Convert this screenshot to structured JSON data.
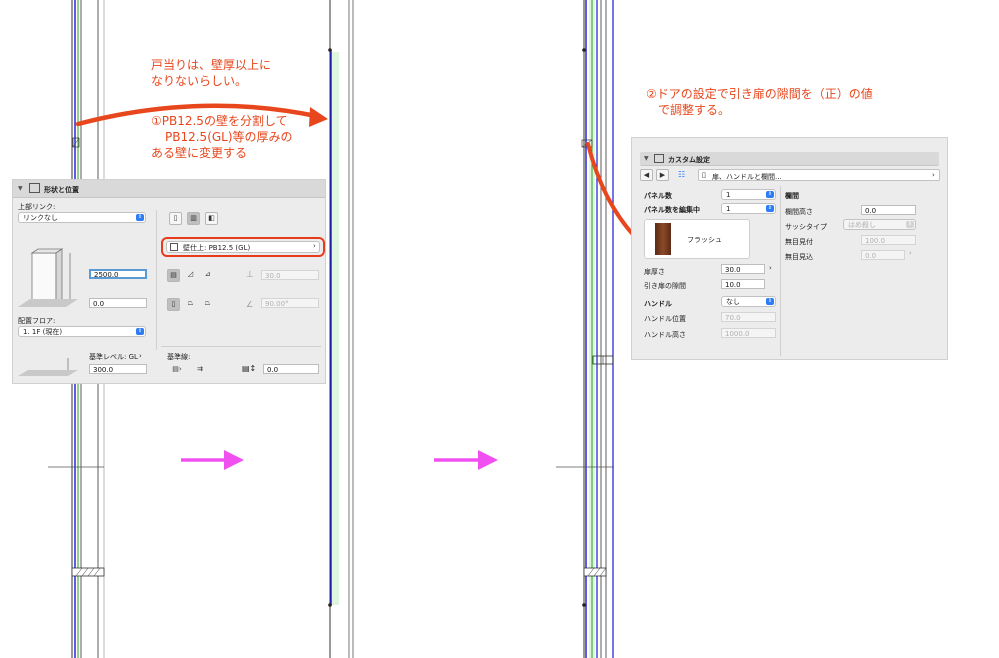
{
  "annotations": {
    "note1_line1": "戸当りは、壁厚以上に",
    "note1_line2": "なりないらしい。",
    "note2_line1": "①PB12.5の壁を分割して",
    "note2_line2": "PB12.5(GL)等の厚みの",
    "note2_line3": "ある壁に変更する",
    "note3_line1": "②ドアの設定で引き扉の隙間を（正）の値",
    "note3_line2": "で調整する。",
    "arrow_color": "#e8461c",
    "flow_arrow_color": "#f050f0"
  },
  "wall_panel": {
    "title": "形状と位置",
    "top_link_label": "上部リンク:",
    "top_link_value": "リンクなし",
    "height_value": "2500.0",
    "offset_value": "0.0",
    "floor_label": "配置フロア:",
    "floor_value": "1. 1F (現在)",
    "composite_label": "壁仕上: PB12.5 (GL)",
    "thickness_value": "30.0",
    "angle_value": "90.00°",
    "ref_level_label": "基準レベル: GL",
    "ref_level_value": "300.0",
    "ref_line_label": "基準線:",
    "ref_line_value": "0.0"
  },
  "door_panel": {
    "title": "カスタム設定",
    "breadcrumb": "扉、ハンドルと欄間...",
    "panel_count_label": "パネル数",
    "panel_count_value": "1",
    "panel_edit_label": "パネル数を編集中",
    "panel_edit_value": "1",
    "flush_label": "フラッシュ",
    "door_thickness_label": "扉厚さ",
    "door_thickness_value": "30.0",
    "gap_label": "引き扉の隙間",
    "gap_value": "10.0",
    "handle_label": "ハンドル",
    "handle_value": "なし",
    "handle_pos_label": "ハンドル位置",
    "handle_pos_value": "70.0",
    "handle_height_label": "ハンドル高さ",
    "handle_height_value": "1000.0",
    "transom_label": "欄間",
    "transom_height_label": "欄間高さ",
    "transom_height_value": "0.0",
    "sash_type_label": "サッシタイプ",
    "sash_type_value": "はめ殺し",
    "frame_label": "無目見付",
    "frame_value": "100.0",
    "frame_depth_label": "無目見込",
    "frame_depth_value": "0.0"
  }
}
